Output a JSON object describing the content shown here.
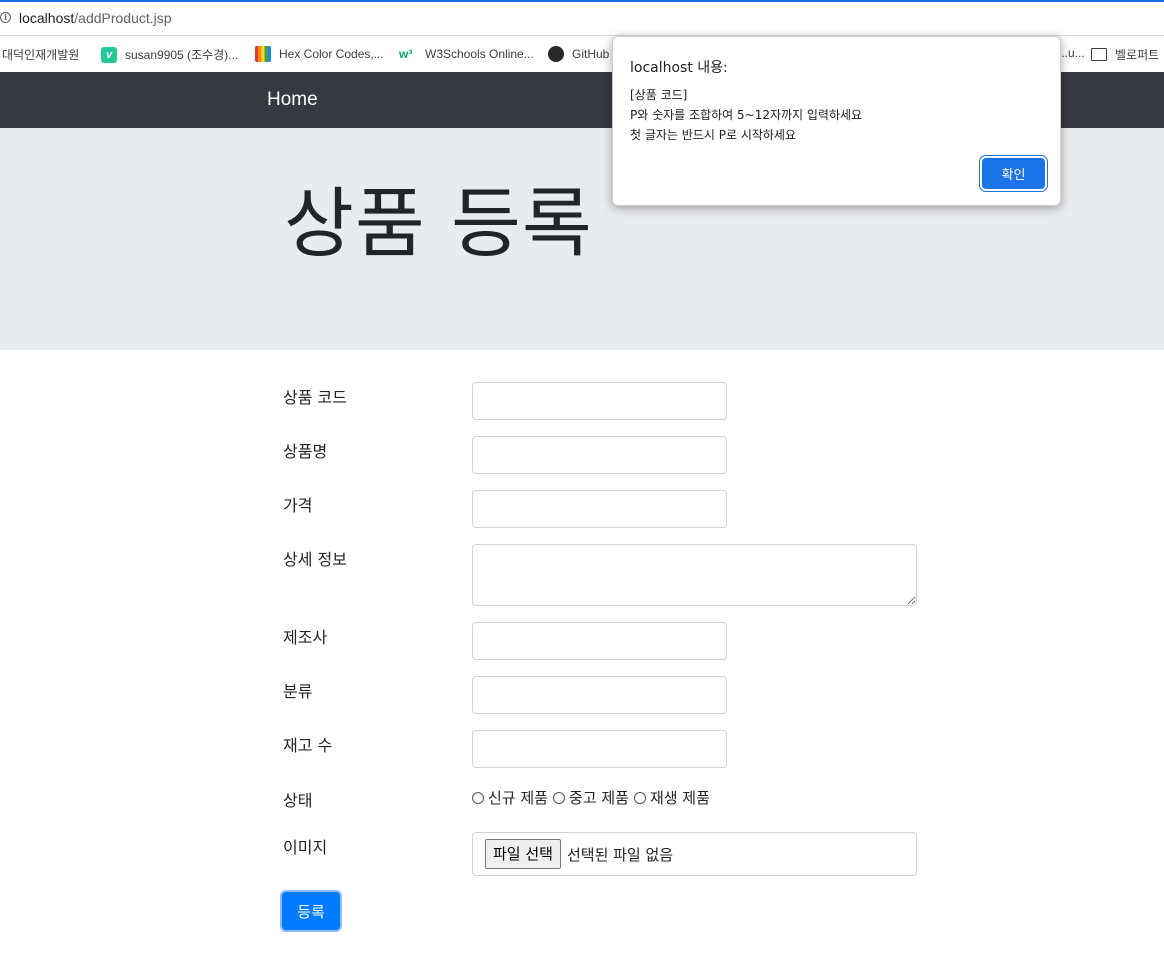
{
  "browser": {
    "url_host": "localhost",
    "url_path": "/addProduct.jsp",
    "bookmarks": [
      {
        "label": "대덕인재개발원",
        "icon": "none"
      },
      {
        "label": "susan9905 (조수경)...",
        "icon": "velog-icon"
      },
      {
        "label": "Hex Color Codes,...",
        "icon": "color-palette-icon"
      },
      {
        "label": "W3Schools Online...",
        "icon": "w3schools-icon"
      },
      {
        "label": "GitHub",
        "icon": "github-icon"
      },
      {
        "label": "...u...",
        "icon": "none"
      },
      {
        "label": "벨로퍼트",
        "icon": "book-icon"
      }
    ]
  },
  "navbar": {
    "brand": "Home"
  },
  "jumbotron": {
    "title": "상품 등록"
  },
  "form": {
    "product_code_label": "상품 코드",
    "product_name_label": "상품명",
    "price_label": "가격",
    "description_label": "상세 정보",
    "manufacturer_label": "제조사",
    "category_label": "분류",
    "stock_label": "재고 수",
    "condition_label": "상태",
    "condition_options": [
      "신규 제품",
      "중고 제품",
      "재생 제품"
    ],
    "image_label": "이미지",
    "file_button_label": "파일 선택",
    "file_status": "선택된 파일 없음",
    "submit_label": "등록"
  },
  "alert": {
    "title": "localhost 내용:",
    "message_lines": [
      "[상품 코드]",
      "P와 숫자를 조합하여 5~12자까지 입력하세요",
      "첫 글자는 반드시 P로 시작하세요"
    ],
    "ok_label": "확인"
  },
  "colors": {
    "navbar": "#343a40",
    "jumbotron": "#e9ecef",
    "primary": "#007bff",
    "dialog_button": "#1a73e8"
  }
}
